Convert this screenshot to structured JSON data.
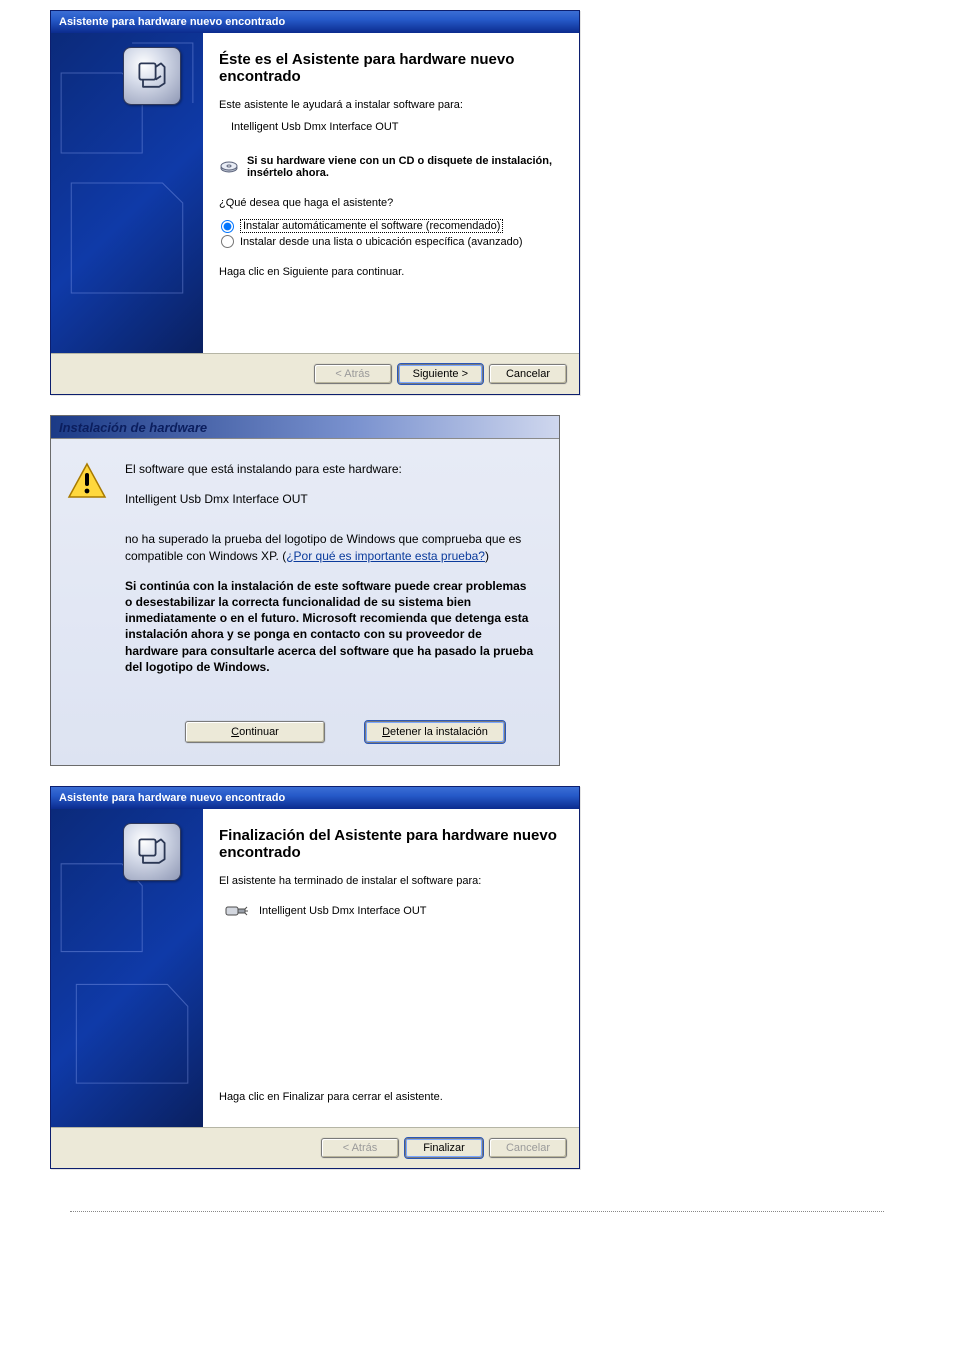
{
  "dlg1": {
    "title": "Asistente para hardware nuevo encontrado",
    "heading": "Éste es el Asistente para hardware nuevo encontrado",
    "intro": "Este asistente le ayudará a instalar software para:",
    "device": "Intelligent Usb Dmx Interface OUT",
    "cd_hint": "Si su hardware viene con un CD o disquete de instalación, insértelo ahora.",
    "prompt": "¿Qué desea que haga el asistente?",
    "opt_auto": "Instalar automáticamente el software (recomendado)",
    "opt_list": "Instalar desde una lista o ubicación específica (avanzado)",
    "continue_hint": "Haga clic en Siguiente para continuar.",
    "btn_back": "< Atrás",
    "btn_next": "Siguiente >",
    "btn_cancel": "Cancelar"
  },
  "dlg2": {
    "title": "Instalación de hardware",
    "line1": "El software que está instalando para este hardware:",
    "device": "Intelligent Usb Dmx Interface OUT",
    "line2a": "no ha superado la prueba del logotipo de Windows que comprueba que es compatible con Windows XP. (",
    "link": "¿Por qué es importante esta prueba?",
    "line2b": ")",
    "warning": "Si continúa con la instalación de este software puede crear problemas o desestabilizar la correcta funcionalidad de su sistema bien inmediatamente o en el futuro. Microsoft recomienda que detenga esta instalación ahora y se ponga en contacto con su proveedor de hardware para consultarle acerca del software que ha pasado la prueba del logotipo de Windows.",
    "btn_continue": "Continuar",
    "btn_stop": "Detener la instalación"
  },
  "dlg3": {
    "title": "Asistente para hardware nuevo encontrado",
    "heading": "Finalización del Asistente para hardware nuevo encontrado",
    "intro": "El asistente ha terminado de instalar el software para:",
    "device": "Intelligent Usb Dmx Interface OUT",
    "close_hint": "Haga clic en Finalizar para cerrar el asistente.",
    "btn_back": "< Atrás",
    "btn_finish": "Finalizar",
    "btn_cancel": "Cancelar"
  }
}
